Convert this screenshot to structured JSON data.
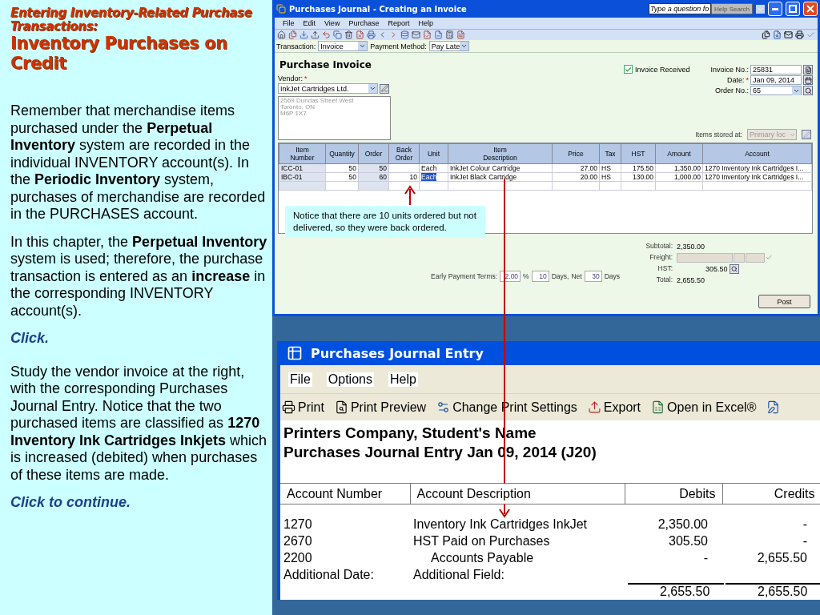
{
  "slide": {
    "subtitle": "Entering Inventory-Related Purchase Transactions:",
    "title": "Inventory Purchases on Credit",
    "paragraphs": [
      {
        "kind": "text",
        "text": "Remember that merchandise items purchased under the **Perpetual Inventory** system are recorded in the individual INVENTORY account(s). In the **Periodic Inventory** system, purchases of merchandise are recorded in the PURCHASES account."
      },
      {
        "kind": "text",
        "text": "In this chapter, the **Perpetual Inventory** system is used; therefore, the purchase transaction is entered as an **increase** in the corresponding INVENTORY account(s)."
      },
      {
        "kind": "prompt",
        "text": "Click."
      },
      {
        "kind": "text",
        "text": "Study the vendor invoice at the right, with the corresponding Purchases Journal Entry. Notice that the two purchased items are classified as **1270 Inventory Ink Cartridges Inkjets** which is increased (debited) when purchases of these items are  made."
      },
      {
        "kind": "prompt",
        "text": "Click to continue."
      }
    ]
  },
  "invoice_window": {
    "title": "Purchases Journal - Creating an Invoice",
    "help_field": {
      "placeholder": "Type a question fo"
    },
    "help_button": "Help Search",
    "menu": [
      "File",
      "Edit",
      "View",
      "Purchase",
      "Report",
      "Help"
    ],
    "transaction": {
      "label": "Transaction:",
      "value": "Invoice"
    },
    "payment_method": {
      "label": "Payment Method:",
      "value": "Pay Late"
    },
    "form_title": "Purchase Invoice",
    "vendor": {
      "label": "Vendor:",
      "mark": "*",
      "value": "InkJet Cartridges Ltd."
    },
    "address": [
      "2569 Dundas Street West",
      "Toronto, ON",
      "M6P 1X7"
    ],
    "invoice_received": {
      "label": "Invoice Received",
      "checked": true
    },
    "fields": [
      {
        "kind": "number",
        "label": "Invoice No.:",
        "value": "25831"
      },
      {
        "kind": "date",
        "label": "Date:",
        "mark": "*",
        "value": "Jan 09, 2014"
      },
      {
        "kind": "dropdown",
        "label": "Order No.:",
        "value": "65"
      }
    ],
    "items_stored": {
      "label": "Items stored at:",
      "value": "Primary loc",
      "disabled": true
    },
    "columns": [
      "Item\nNumber",
      "Quantity",
      "Order",
      "Back\nOrder",
      "Unit",
      "Item\nDescription",
      "Price",
      "Tax",
      "HST",
      "Amount",
      "Account"
    ],
    "rows": [
      {
        "item": "ICC-01",
        "quantity": "50",
        "order": "50",
        "unit": "Each",
        "unit_selected": false,
        "description": "InkJet Colour Cartridge",
        "price": "27.00",
        "tax": "HS",
        "hst": "175.50",
        "amount": "1,350.00",
        "account": "1270 Inventory Ink Cartridges I..."
      },
      {
        "item": "IBC-01",
        "quantity": "50",
        "order": "60",
        "back_order": "10",
        "unit": "Each",
        "unit_selected": true,
        "description": "InkJet Black Cartridge",
        "price": "20.00",
        "tax": "HS",
        "hst": "130.00",
        "amount": "1,000.00",
        "account": "1270 Inventory Ink Cartridges I..."
      }
    ],
    "callout": "Notice that there are 10 units ordered but not delivered, so they were back ordered.",
    "early_payment": {
      "label": "Early Payment Terms:",
      "percent": "2.00",
      "percent_sign": "%",
      "days": "10",
      "days_label": "Days,",
      "net_label": "Net",
      "net_days": "30",
      "net_days_label": "Days"
    },
    "totals": [
      {
        "kind": "text",
        "label": "Subtotal:",
        "value": "2,350.00"
      },
      {
        "kind": "freight",
        "label": "Freight:"
      },
      {
        "kind": "lookup",
        "label": "HST:",
        "value": "305.50"
      },
      {
        "kind": "text",
        "label": "Total:",
        "value": "2,655.50"
      }
    ],
    "post_button": "Post"
  },
  "journal_window": {
    "title": "Purchases Journal Entry",
    "menu": [
      "File",
      "Options",
      "Help"
    ],
    "toolbar": [
      {
        "kind": "print",
        "label": "Print"
      },
      {
        "kind": "preview",
        "label": "Print Preview"
      },
      {
        "kind": "settings",
        "label": "Change Print Settings"
      },
      {
        "kind": "export",
        "label": "Export"
      },
      {
        "kind": "excel",
        "label": "Open in Excel®"
      },
      {
        "kind": "modify"
      }
    ],
    "company": "Printers Company, Student's Name",
    "entry_title": "Purchases Journal Entry Jan 09, 2014 (J20)",
    "columns": [
      "Account Number",
      "Account Description",
      "Debits",
      "Credits"
    ],
    "rows": [
      {
        "number": "1270",
        "description": "Inventory Ink Cartridges InkJet",
        "indented": false,
        "debit": "2,350.00",
        "credit": "-"
      },
      {
        "number": "2670",
        "description": "HST Paid on Purchases",
        "indented": false,
        "debit": "305.50",
        "credit": "-"
      },
      {
        "number": "2200",
        "description": "Accounts Payable",
        "indented": true,
        "debit": "-",
        "credit": "2,655.50"
      },
      {
        "number": "Additional Date:",
        "description": "Additional Field:",
        "indented": false
      }
    ],
    "totals": {
      "debit": "2,655.50",
      "credit": "2,655.50"
    }
  }
}
